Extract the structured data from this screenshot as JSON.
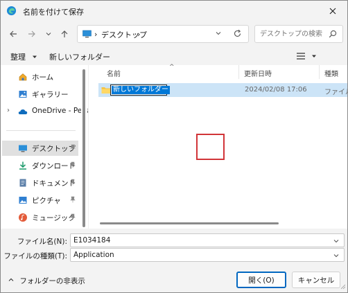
{
  "window": {
    "title": "名前を付けて保存",
    "accent": "#0078d7",
    "app_icon": "edge-icon"
  },
  "nav": {
    "breadcrumb": "デスクトップ",
    "search_placeholder": "デスクトップの検索"
  },
  "toolbar": {
    "organize_label": "整理",
    "new_folder_label": "新しいフォルダー"
  },
  "sidebar": {
    "items": [
      {
        "label": "ホーム",
        "icon": "home-icon"
      },
      {
        "label": "ギャラリー",
        "icon": "gallery-icon"
      },
      {
        "label": "OneDrive - Perso",
        "icon": "onedrive-icon"
      },
      {
        "label": "デスクトップ",
        "icon": "desktop-icon",
        "selected": true
      },
      {
        "label": "ダウンロード",
        "icon": "download-icon"
      },
      {
        "label": "ドキュメント",
        "icon": "document-icon"
      },
      {
        "label": "ピクチャ",
        "icon": "picture-icon"
      },
      {
        "label": "ミュージック",
        "icon": "music-icon"
      }
    ]
  },
  "files": {
    "columns": [
      "名前",
      "更新日時",
      "種類"
    ],
    "rows": [
      {
        "name": "新しいフォルダー",
        "date": "2024/02/08 17:06",
        "type": "ファイル フ"
      }
    ]
  },
  "fields": {
    "filename_label": "ファイル名(N):",
    "filename_value": "E1034184",
    "filetype_label": "ファイルの種類(T):",
    "filetype_value": "Application"
  },
  "footer": {
    "hide_folders_label": "フォルダーの非表示",
    "open_label": "開く(O)",
    "cancel_label": "キャンセル"
  }
}
